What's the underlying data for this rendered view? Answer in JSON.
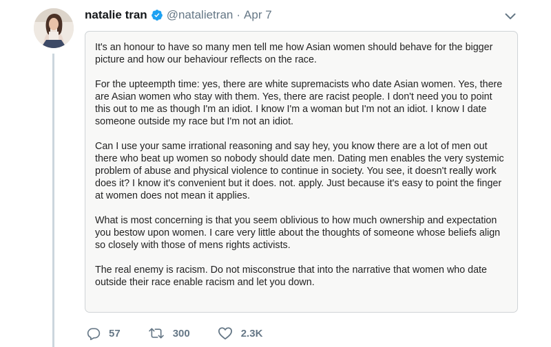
{
  "author": {
    "name": "natalie tran",
    "handle": "@natalietran",
    "separator": "·",
    "date": "Apr 7",
    "verified": true
  },
  "colors": {
    "verified_badge": "#1da1f2",
    "secondary_text": "#657786",
    "thread_line": "#ccd6dd"
  },
  "icons": {
    "verified": "verified-badge-icon",
    "menu": "chevron-down-icon",
    "reply": "reply-icon",
    "retweet": "retweet-icon",
    "like": "heart-icon"
  },
  "content": {
    "paragraphs": [
      "It's an honour to have so many men tell me how Asian women should behave for the bigger picture and how our behaviour reflects on the race.",
      "For the upteempth time: yes, there are white supremacists who date Asian women. Yes, there are Asian women who stay with them. Yes, there are racist people. I don't need you to point this out to me as though I'm an idiot. I know I'm a woman but I'm not an idiot. I know I date someone outside my race but I'm not an idiot.",
      "Can I use your same irrational reasoning and say hey, you know there are a lot of men out there who beat up women so nobody should date men. Dating men enables the very systemic problem of abuse and physical violence to continue in society. You see, it doesn't really work does it? I know it's convenient but it does. not. apply. Just because it's easy to point the finger at women does not mean it applies.",
      "What is most concerning is that you seem oblivious to how much ownership and expectation you bestow upon women. I care very little about the thoughts of someone whose beliefs align so closely with those of mens rights activists.",
      "The real enemy is racism. Do not misconstrue that into the narrative that women who date outside their race enable racism and let you down."
    ]
  },
  "stats": {
    "replies": "57",
    "retweets": "300",
    "likes": "2.3K"
  }
}
